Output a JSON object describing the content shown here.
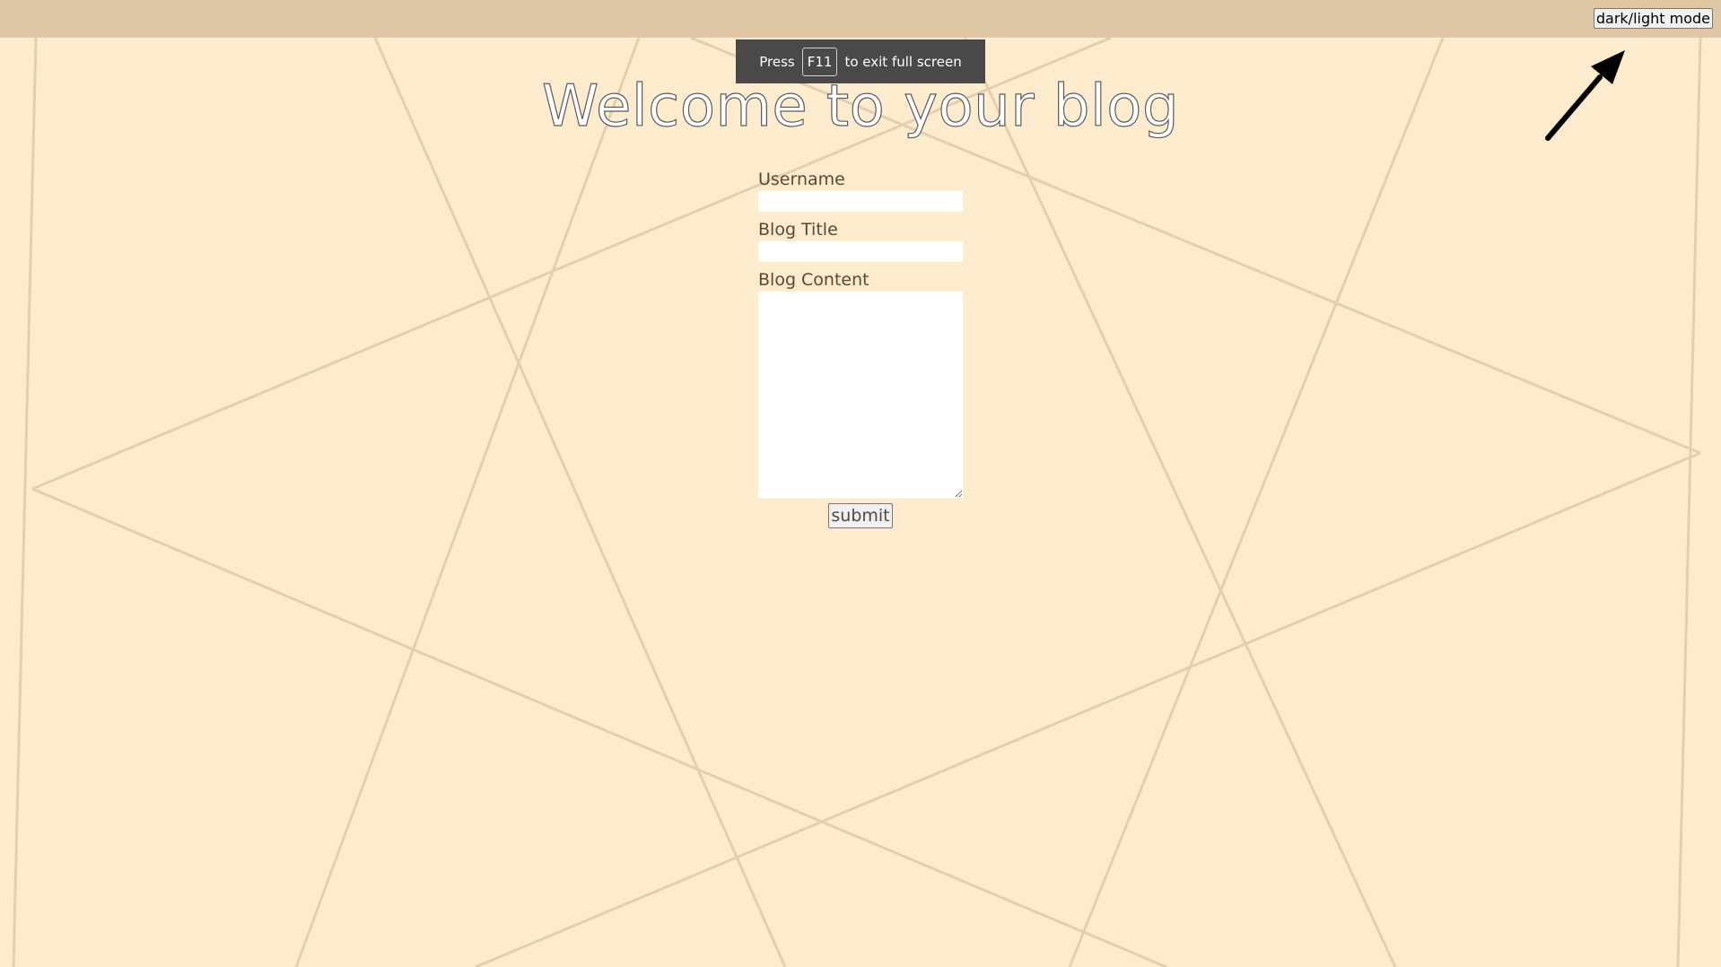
{
  "header": {
    "mode_toggle_label": "dark/light mode"
  },
  "fullscreen_notice": {
    "prefix": "Press",
    "key": "F11",
    "suffix": "to exit full screen"
  },
  "page_title": "Welcome to your blog",
  "form": {
    "username_label": "Username",
    "username_value": "",
    "blog_title_label": "Blog Title",
    "blog_title_value": "",
    "blog_content_label": "Blog Content",
    "blog_content_value": "",
    "submit_label": "submit"
  },
  "colors": {
    "background": "#fdebcd",
    "top_bar": "#dfc6a4",
    "lines": "#e2cfaf",
    "notice_bg": "#4a4948",
    "label_text": "#5b4a33"
  },
  "icons": {
    "annotation_arrow": "arrow-up-right-icon"
  }
}
